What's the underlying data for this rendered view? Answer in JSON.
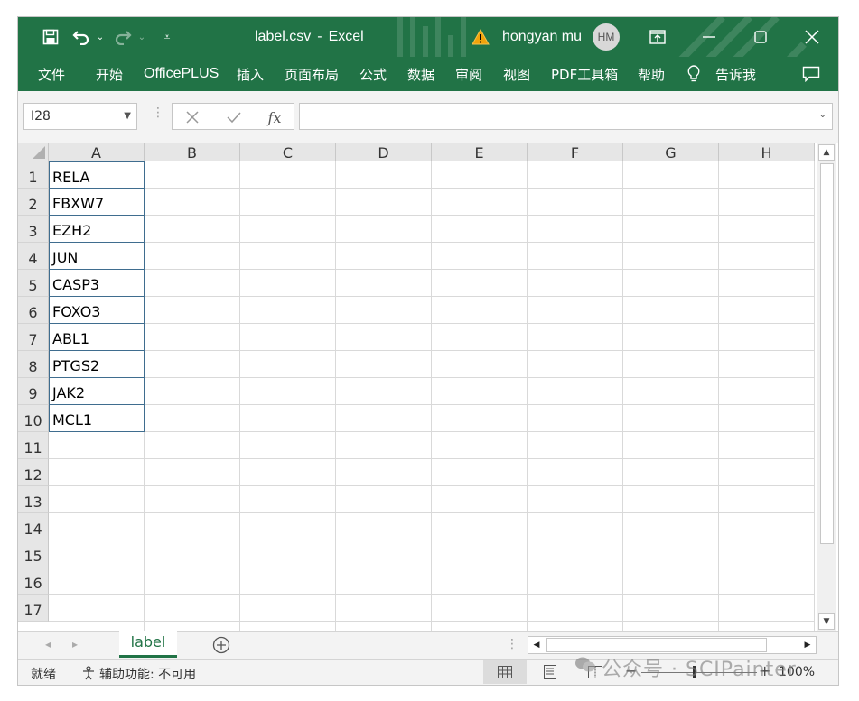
{
  "titlebar": {
    "filename": "label.csv",
    "separator": "-",
    "app_name": "Excel",
    "user_name": "hongyan mu",
    "avatar_initials": "HM"
  },
  "ribbon": {
    "tabs": [
      "文件",
      "开始",
      "OfficePLUS",
      "插入",
      "页面布局",
      "公式",
      "数据",
      "审阅",
      "视图",
      "PDF工具箱",
      "帮助"
    ],
    "tell_me": "告诉我"
  },
  "formula_bar": {
    "cell_ref": "I28",
    "formula_value": "",
    "fx_label": "fx"
  },
  "sheet": {
    "columns": [
      "A",
      "B",
      "C",
      "D",
      "E",
      "F",
      "G",
      "H"
    ],
    "rows": [
      "1",
      "2",
      "3",
      "4",
      "5",
      "6",
      "7",
      "8",
      "9",
      "10",
      "11",
      "12",
      "13",
      "14",
      "15",
      "16",
      "17"
    ],
    "column_a_values": [
      "RELA",
      "FBXW7",
      "EZH2",
      "JUN",
      "CASP3",
      "FOXO3",
      "ABL1",
      "PTGS2",
      "JAK2",
      "MCL1"
    ]
  },
  "sheet_tabs": {
    "active": "label"
  },
  "statusbar": {
    "ready": "就绪",
    "accessibility": "辅助功能: 不可用",
    "zoom": "100%"
  },
  "watermark": {
    "text": "公众号 · SCIPainter"
  },
  "colors": {
    "brand_green": "#217346",
    "warning": "#f0a30a",
    "selection_border": "#3f6d8f"
  }
}
